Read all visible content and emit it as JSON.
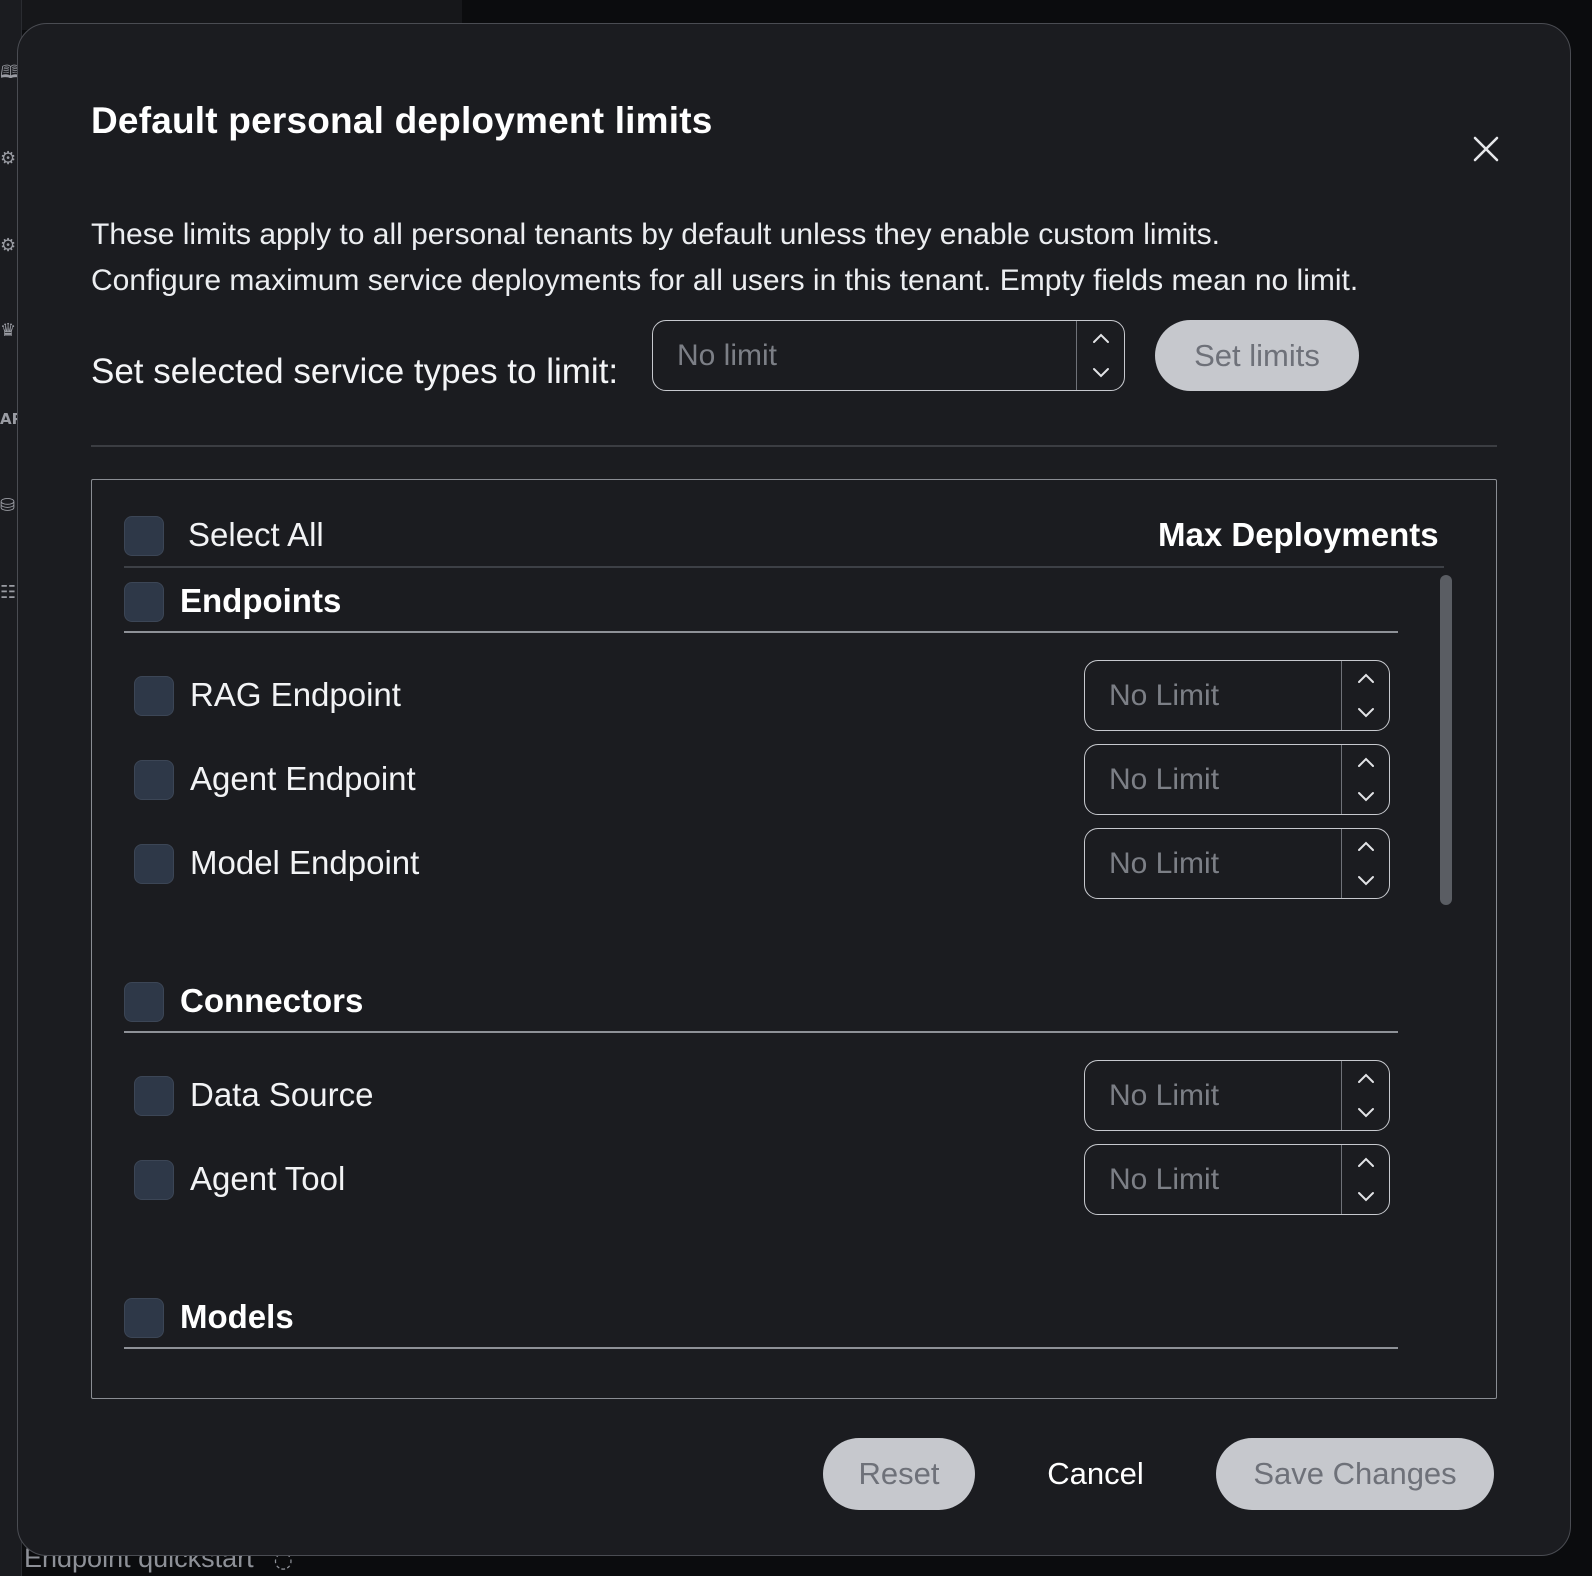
{
  "background": {
    "sidebar_icons": [
      "book-icon",
      "robot-icon",
      "gear-icon",
      "crown-icon",
      "api-icon",
      "database-icon",
      "document-icon"
    ],
    "sidebar_api_text": "API",
    "bottom_link": "Endpoint quickstart"
  },
  "dialog": {
    "title": "Default personal deployment limits",
    "description_line1": "These limits apply to all personal tenants by default unless they enable custom limits.",
    "description_line2": "Configure maximum service deployments for all users in this tenant. Empty fields mean no limit.",
    "bulk": {
      "label": "Set selected service types to limit:",
      "input_placeholder": "No limit",
      "input_value": "",
      "button_label": "Set limits"
    },
    "table": {
      "select_all_label": "Select All",
      "column_header": "Max Deployments",
      "groups": [
        {
          "label": "Endpoints",
          "items": [
            {
              "label": "RAG Endpoint",
              "placeholder": "No Limit"
            },
            {
              "label": "Agent Endpoint",
              "placeholder": "No Limit"
            },
            {
              "label": "Model Endpoint",
              "placeholder": "No Limit"
            }
          ]
        },
        {
          "label": "Connectors",
          "items": [
            {
              "label": "Data Source",
              "placeholder": "No Limit"
            },
            {
              "label": "Agent Tool",
              "placeholder": "No Limit"
            }
          ]
        },
        {
          "label": "Models",
          "items": []
        }
      ]
    },
    "footer": {
      "reset_label": "Reset",
      "cancel_label": "Cancel",
      "save_label": "Save Changes"
    }
  },
  "colors": {
    "dialog_bg": "#1b1c20",
    "checkbox_fill": "#2e3848",
    "disabled_button_bg": "#c6c8cd",
    "disabled_button_text": "#6e7179"
  }
}
